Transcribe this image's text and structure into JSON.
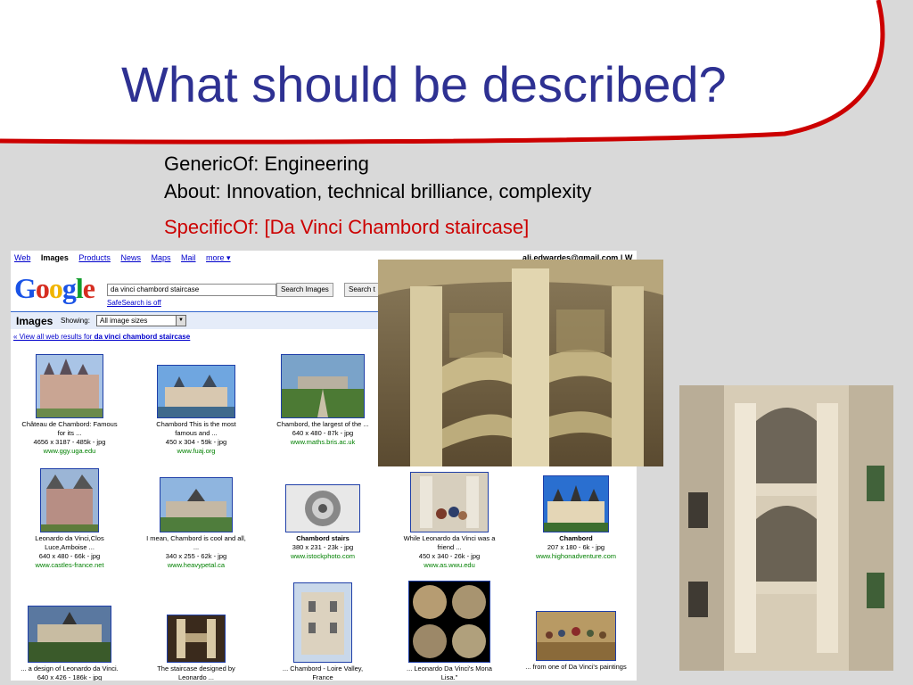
{
  "slide": {
    "title": "What should be described?",
    "lines": [
      "GenericOf: Engineering",
      "About: Innovation, technical brilliance, complexity",
      "SpecificOf: [Da Vinci Chambord staircase]"
    ],
    "colors": {
      "title": "#2e3192",
      "accent_red": "#cc0000",
      "background": "#d9d9d9"
    }
  },
  "google": {
    "nav": [
      "Web",
      "Images",
      "Products",
      "News",
      "Maps",
      "Mail",
      "more ▾"
    ],
    "active_nav": "Images",
    "user": "ali.edwardes@gmail.com | W",
    "logo": [
      "G",
      "o",
      "o",
      "g",
      "l",
      "e"
    ],
    "search_value": "da vinci chambord staircase",
    "search_images_label": "Search Images",
    "search_web_label": "Search t",
    "safesearch": "SafeSearch is off",
    "bar_title": "Images",
    "showing_label": "Showing:",
    "filter_value": "All image sizes",
    "view_all_prefix": "« View all web results for",
    "view_all_query": "da vinci chambord staircase",
    "results": [
      {
        "caption": "Château de Chambord: Famous",
        "more": "for its ...",
        "meta": "4656 x 3187 - 485k - jpg",
        "url": "www.ggy.uga.edu"
      },
      {
        "caption": "Chambord This is the most",
        "more": "famous and ...",
        "meta": "450 x 304 - 59k - jpg",
        "url": "www.fuaj.org"
      },
      {
        "caption": "Chambord, the largest of the ...",
        "more": "",
        "meta": "640 x 480 - 87k - jpg",
        "url": "www.maths.bris.ac.uk"
      },
      {
        "caption": "Leonardo da Vinci,Clos",
        "more": "Luce,Amboise ...",
        "meta": "640 x 480 - 66k - jpg",
        "url": "www.castles-france.net"
      },
      {
        "caption": "I mean, Chambord is cool and all,",
        "more": "...",
        "meta": "340 x 255 - 62k - jpg",
        "url": "www.heavypetal.ca"
      },
      {
        "caption": "Chambord stairs",
        "more": "",
        "meta": "380 x 231 - 23k - jpg",
        "url": "www.istockphoto.com"
      },
      {
        "caption": "While Leonardo da Vinci was a",
        "more": "friend ...",
        "meta": "450 x 340 - 26k - jpg",
        "url": "www.as.wwu.edu"
      },
      {
        "caption": "Chambord",
        "more": "",
        "meta": "207 x 180 - 6k - jpg",
        "url": "www.highonadventure.com"
      },
      {
        "caption": "... a design of Leonardo da Vinci.",
        "more": "",
        "meta": "640 x 426 - 186k - jpg",
        "url": ""
      },
      {
        "caption": "The staircase designed by",
        "more": "Leonardo ...",
        "meta": "",
        "url": ""
      },
      {
        "caption": "... Chambord - Loire Valley,",
        "more": "France",
        "meta": "",
        "url": ""
      },
      {
        "caption": "... Leonardo Da Vinci's Mona",
        "more": "Lisa.\"",
        "meta": "",
        "url": ""
      },
      {
        "caption": "... from one of Da Vinci's paintings",
        "more": "",
        "meta": "",
        "url": ""
      }
    ]
  }
}
